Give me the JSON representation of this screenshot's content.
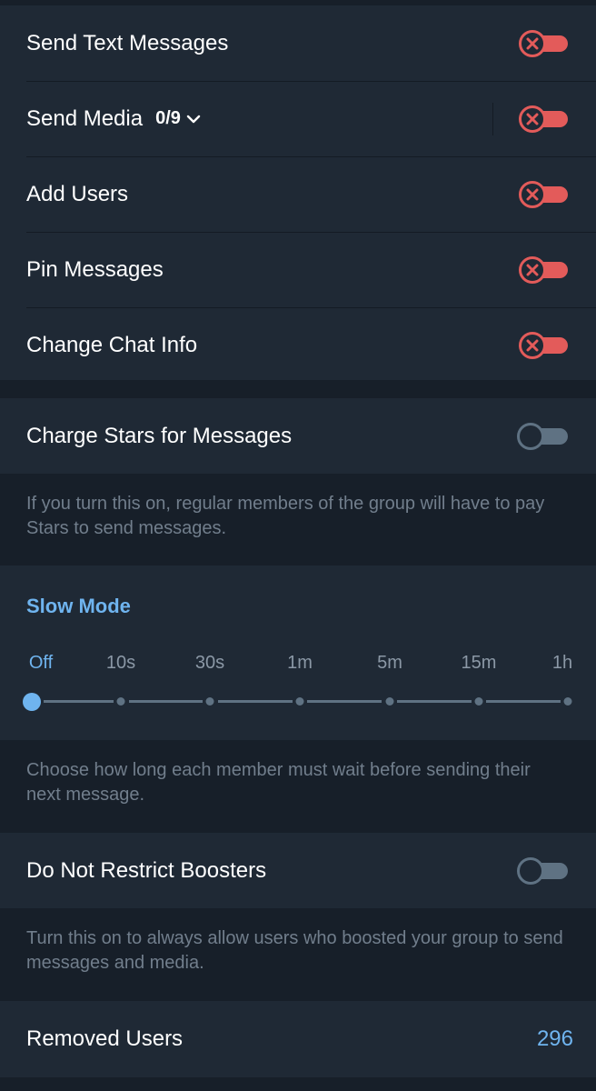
{
  "permissions": {
    "rows": [
      {
        "label": "Send Text Messages",
        "state": "off-locked"
      },
      {
        "label": "Send Media",
        "count": "0/9",
        "state": "off-locked"
      },
      {
        "label": "Add Users",
        "state": "off-locked"
      },
      {
        "label": "Pin Messages",
        "state": "off-locked"
      },
      {
        "label": "Change Chat Info",
        "state": "off-locked"
      }
    ]
  },
  "charge_stars": {
    "label": "Charge Stars for Messages",
    "enabled": false,
    "info": "If you turn this on, regular members of the group will have to pay Stars to send messages."
  },
  "slow_mode": {
    "title": "Slow Mode",
    "options": [
      "Off",
      "10s",
      "30s",
      "1m",
      "5m",
      "15m",
      "1h"
    ],
    "selected": "Off",
    "info": "Choose how long each member must wait before sending their next message."
  },
  "boosters": {
    "label": "Do Not Restrict Boosters",
    "enabled": false,
    "info": "Turn this on to always allow users who boosted your group to send messages and media."
  },
  "removed_users": {
    "label": "Removed Users",
    "count": "296"
  },
  "colors": {
    "background": "#171f29",
    "card": "#1f2935",
    "accent": "#6fb4ef",
    "locked_red": "#e35b5a",
    "toggle_grey": "#5f7283"
  },
  "icons": {
    "locked_toggle": "x-mark-icon",
    "expand": "chevron-down-icon"
  }
}
